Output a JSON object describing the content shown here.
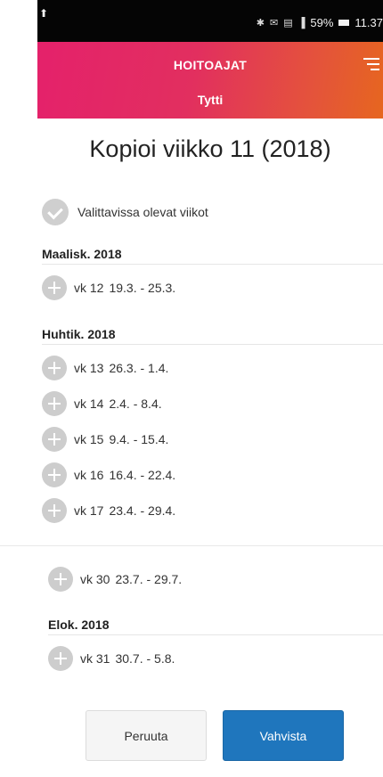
{
  "status_bar": {
    "left_glyph": "⬆",
    "icons": [
      "✱",
      "✉",
      "▤",
      "▐"
    ],
    "battery_text": "59%",
    "time": "11.37"
  },
  "header": {
    "title": "HOITOAJAT",
    "subtitle": "Tytti",
    "menu_icon": "hamburger-icon"
  },
  "page": {
    "title": "Kopioi viikko 11 (2018)",
    "legend_label": "Valittavissa olevat viikot"
  },
  "groups": [
    {
      "header": "Maalisk. 2018",
      "weeks": [
        {
          "week": "vk 12",
          "range": "19.3. - 25.3."
        }
      ]
    },
    {
      "header": "Huhtik. 2018",
      "weeks": [
        {
          "week": "vk 13",
          "range": "26.3. - 1.4."
        },
        {
          "week": "vk 14",
          "range": "2.4. - 8.4."
        },
        {
          "week": "vk 15",
          "range": "9.4. - 15.4."
        },
        {
          "week": "vk 16",
          "range": "16.4. - 22.4."
        },
        {
          "week": "vk 17",
          "range": "23.4. - 29.4."
        }
      ]
    },
    {
      "header": "",
      "weeks": [
        {
          "week": "vk 30",
          "range": "23.7. - 29.7."
        }
      ]
    },
    {
      "header": "Elok. 2018",
      "weeks": [
        {
          "week": "vk 31",
          "range": "30.7. - 5.8."
        }
      ]
    }
  ],
  "buttons": {
    "cancel": "Peruuta",
    "confirm": "Vahvista"
  },
  "colors": {
    "header_start": "#e4216b",
    "header_end": "#e6661f",
    "confirm": "#1f76bd"
  }
}
